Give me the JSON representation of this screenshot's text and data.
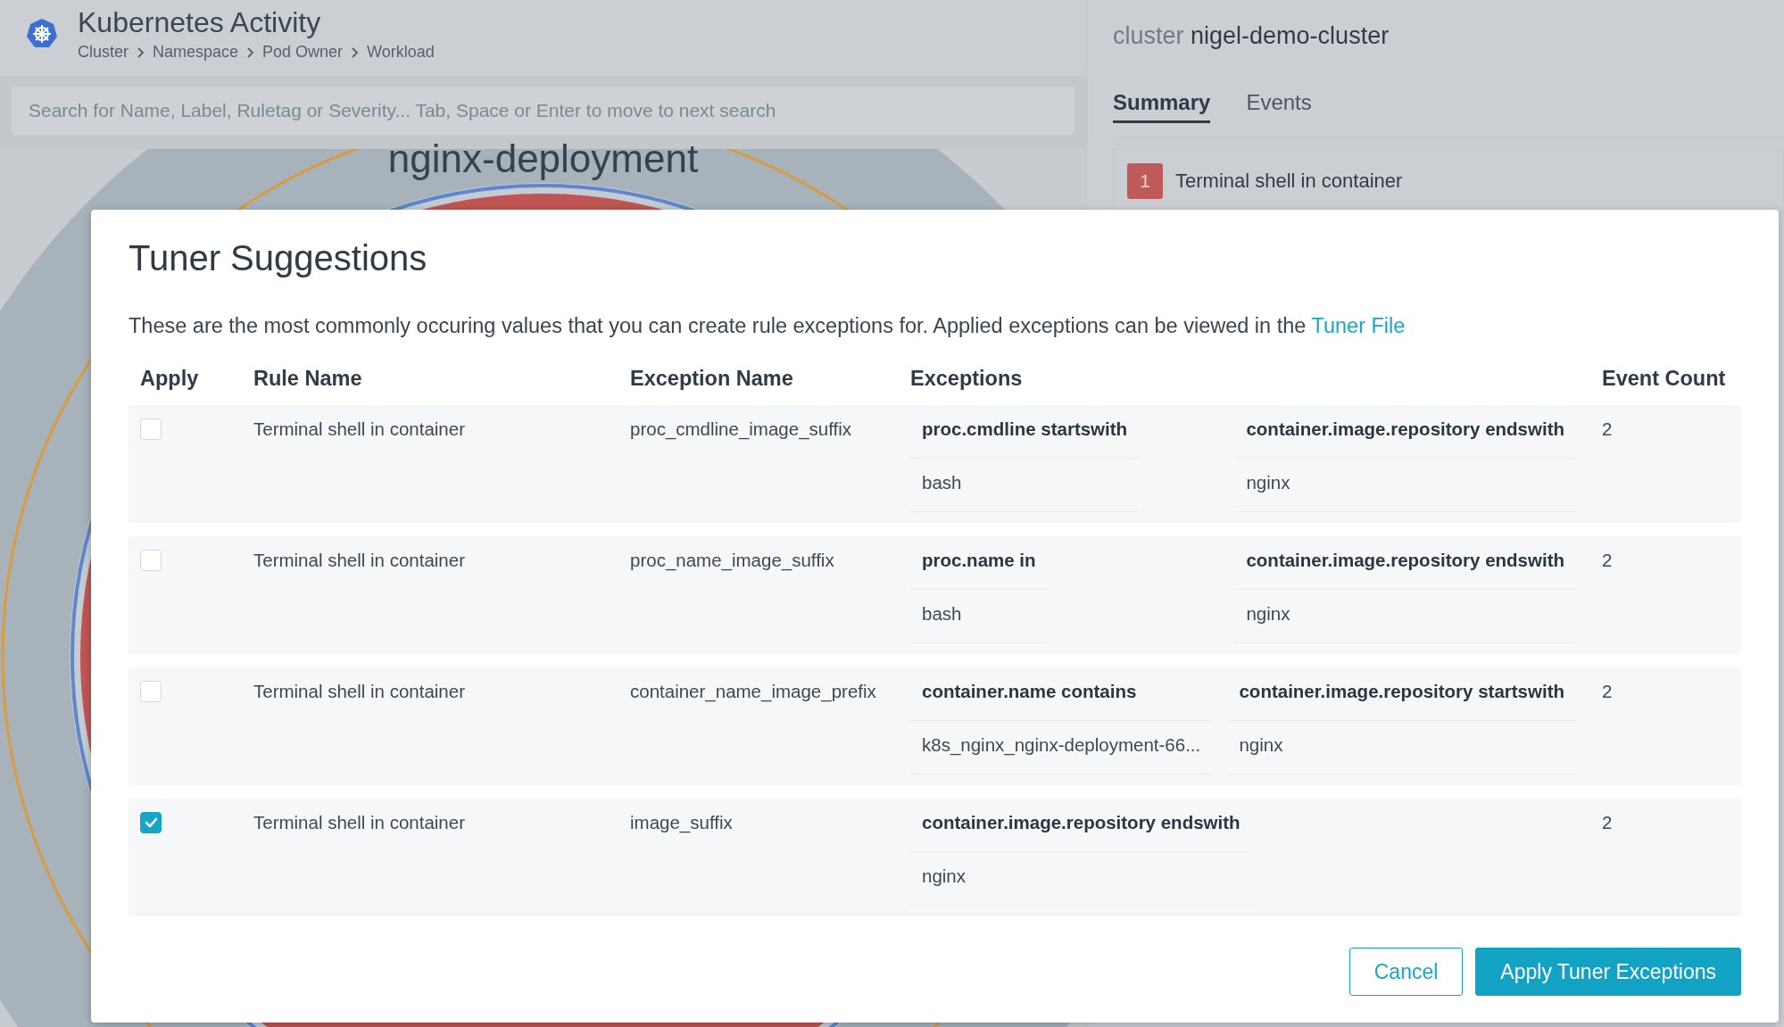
{
  "app": {
    "title": "Kubernetes Activity",
    "breadcrumb": [
      "Cluster",
      "Namespace",
      "Pod Owner",
      "Workload"
    ]
  },
  "search": {
    "placeholder": "Search for Name, Label, Ruletag or Severity... Tab, Space or Enter to move to next search"
  },
  "chart_label": "nginx-deployment",
  "cluster": {
    "prefix": "cluster",
    "name": "nigel-demo-cluster"
  },
  "tabs": [
    {
      "label": "Summary",
      "selected": true
    },
    {
      "label": "Events",
      "selected": false
    }
  ],
  "alerts": [
    {
      "count": "1",
      "name": "Terminal shell in container",
      "color": "#c0595a"
    }
  ],
  "modal": {
    "title": "Tuner Suggestions",
    "description": "These are the most commonly occuring values that you can create rule exceptions for. Applied exceptions can be viewed in the",
    "link": "Tuner File",
    "columns": [
      "Apply",
      "Rule Name",
      "Exception Name",
      "Exceptions",
      "Event Count"
    ],
    "rows": [
      {
        "apply": false,
        "rule_name": "Terminal shell in container",
        "exception_name": "proc_cmdline_image_suffix",
        "exceptions": [
          {
            "field": "proc.cmdline startswith",
            "value": "bash"
          },
          {
            "field": "container.image.repository endswith",
            "value": "nginx"
          }
        ],
        "event_count": "2"
      },
      {
        "apply": false,
        "rule_name": "Terminal shell in container",
        "exception_name": "proc_name_image_suffix",
        "exceptions": [
          {
            "field": "proc.name in",
            "value": "bash"
          },
          {
            "field": "container.image.repository endswith",
            "value": "nginx"
          }
        ],
        "event_count": "2"
      },
      {
        "apply": false,
        "rule_name": "Terminal shell in container",
        "exception_name": "container_name_image_prefix",
        "exceptions": [
          {
            "field": "container.name contains",
            "value": "k8s_nginx_nginx-deployment-66..."
          },
          {
            "field": "container.image.repository startswith",
            "value": "nginx"
          }
        ],
        "event_count": "2"
      },
      {
        "apply": true,
        "rule_name": "Terminal shell in container",
        "exception_name": "image_suffix",
        "exceptions": [
          {
            "field": "container.image.repository endswith",
            "value": "nginx"
          }
        ],
        "event_count": "2"
      }
    ],
    "buttons": [
      {
        "label": "Cancel",
        "kind": "secondary"
      },
      {
        "label": "Apply Tuner Exceptions",
        "kind": "primary"
      }
    ]
  }
}
